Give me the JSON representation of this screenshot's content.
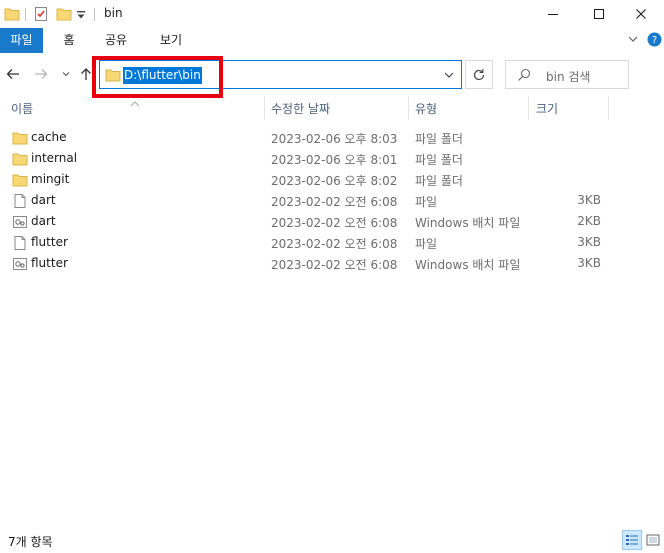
{
  "window": {
    "title": "bin"
  },
  "ribbon": {
    "tabs": [
      "파일",
      "홈",
      "공유",
      "보기"
    ]
  },
  "address": {
    "path": "D:\\flutter\\bin"
  },
  "search": {
    "placeholder": "bin 검색"
  },
  "columns": {
    "name": "이름",
    "date": "수정한 날짜",
    "type": "유형",
    "size": "크기"
  },
  "files": [
    {
      "name": "cache",
      "date": "2023-02-06 오후 8:03",
      "type": "파일 폴더",
      "size": "",
      "icon": "folder-icon"
    },
    {
      "name": "internal",
      "date": "2023-02-06 오후 8:01",
      "type": "파일 폴더",
      "size": "",
      "icon": "folder-icon"
    },
    {
      "name": "mingit",
      "date": "2023-02-06 오후 8:02",
      "type": "파일 폴더",
      "size": "",
      "icon": "folder-icon"
    },
    {
      "name": "dart",
      "date": "2023-02-02 오전 6:08",
      "type": "파일",
      "size": "3KB",
      "icon": "file-icon"
    },
    {
      "name": "dart",
      "date": "2023-02-02 오전 6:08",
      "type": "Windows 배치 파일",
      "size": "2KB",
      "icon": "batch-file-icon"
    },
    {
      "name": "flutter",
      "date": "2023-02-02 오전 6:08",
      "type": "파일",
      "size": "3KB",
      "icon": "file-icon"
    },
    {
      "name": "flutter",
      "date": "2023-02-02 오전 6:08",
      "type": "Windows 배치 파일",
      "size": "3KB",
      "icon": "batch-file-icon"
    }
  ],
  "status": {
    "item_count": "7개 항목"
  },
  "colors": {
    "accent": "#0078d7",
    "file_tab": "#1979ca",
    "highlight_box": "#e60012",
    "folder": "#f8d775"
  }
}
